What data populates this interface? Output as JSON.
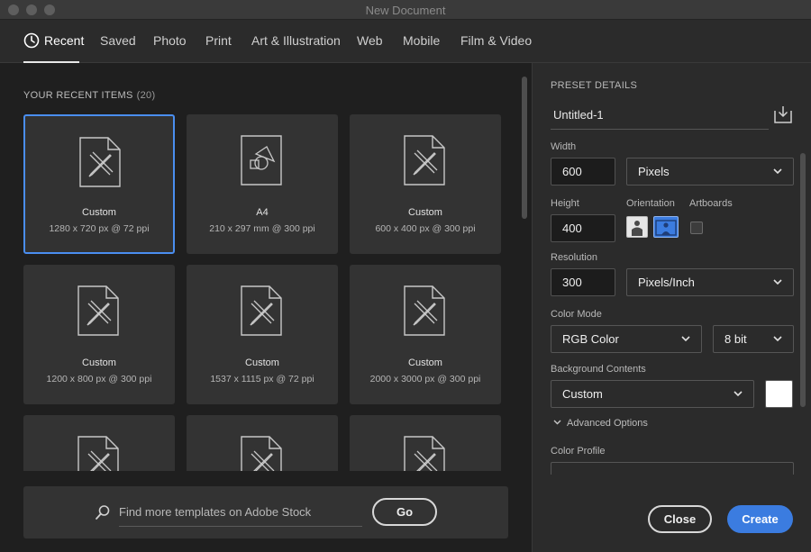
{
  "window": {
    "title": "New Document"
  },
  "tabs": [
    {
      "label": "Recent"
    },
    {
      "label": "Saved"
    },
    {
      "label": "Photo"
    },
    {
      "label": "Print"
    },
    {
      "label": "Art & Illustration"
    },
    {
      "label": "Web"
    },
    {
      "label": "Mobile"
    },
    {
      "label": "Film & Video"
    }
  ],
  "recent": {
    "heading": "YOUR RECENT ITEMS",
    "count": "(20)",
    "items": [
      {
        "title": "Custom",
        "subtitle": "1280 x 720 px @ 72 ppi",
        "icon": "pencil-ruler-doc-icon",
        "selected": true
      },
      {
        "title": "A4",
        "subtitle": "210 x 297 mm @ 300 ppi",
        "icon": "shapes-doc-icon"
      },
      {
        "title": "Custom",
        "subtitle": "600 x 400 px @ 300 ppi",
        "icon": "pencil-ruler-doc-icon"
      },
      {
        "title": "Custom",
        "subtitle": "1200 x 800 px @ 300 ppi",
        "icon": "pencil-ruler-doc-icon"
      },
      {
        "title": "Custom",
        "subtitle": "1537 x 1115 px @ 72 ppi",
        "icon": "pencil-ruler-doc-icon"
      },
      {
        "title": "Custom",
        "subtitle": "2000 x 3000 px @ 300 ppi",
        "icon": "pencil-ruler-doc-icon"
      },
      {
        "title": "",
        "subtitle": "",
        "icon": "pencil-ruler-doc-icon"
      },
      {
        "title": "",
        "subtitle": "",
        "icon": "pencil-ruler-doc-icon"
      },
      {
        "title": "",
        "subtitle": "",
        "icon": "pencil-ruler-doc-icon"
      }
    ]
  },
  "search": {
    "placeholder": "Find more templates on Adobe Stock",
    "go_label": "Go"
  },
  "preset": {
    "heading": "PRESET DETAILS",
    "name": "Untitled-1",
    "width_label": "Width",
    "width_value": "600",
    "width_unit": "Pixels",
    "height_label": "Height",
    "height_value": "400",
    "orientation_label": "Orientation",
    "orientation_selected": "landscape",
    "artboards_label": "Artboards",
    "artboards_checked": false,
    "resolution_label": "Resolution",
    "resolution_value": "300",
    "resolution_unit": "Pixels/Inch",
    "color_mode_label": "Color Mode",
    "color_mode": "RGB Color",
    "bit_depth": "8 bit",
    "background_label": "Background Contents",
    "background": "Custom",
    "background_color": "#ffffff",
    "advanced_label": "Advanced Options",
    "color_profile_label": "Color Profile"
  },
  "actions": {
    "close_label": "Close",
    "create_label": "Create"
  },
  "colors": {
    "accent": "#3b7ce0",
    "selection": "#4a8ef0"
  }
}
